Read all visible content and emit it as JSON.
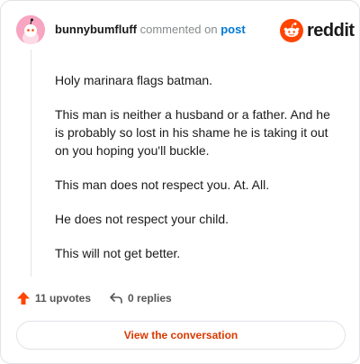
{
  "header": {
    "username": "bunnybumfluff",
    "commented_on": "commented on",
    "post_link": "post",
    "brand": "reddit"
  },
  "comment": {
    "paragraphs": [
      "Holy marinara flags batman.",
      "This man is neither a husband or a father. And he is probably so lost in his shame he is taking it out on you hoping you'll buckle.",
      "This man does not respect you. At. All.",
      "He does not respect your child.",
      "This will not get better."
    ]
  },
  "actions": {
    "upvotes": "11 upvotes",
    "replies": "0 replies"
  },
  "cta": {
    "label": "View the conversation"
  },
  "colors": {
    "brand_orange": "#ff4500",
    "link_blue": "#0079d3",
    "cta_text": "#d93a00"
  },
  "icons": {
    "avatar": "snoo-avatar",
    "brand": "reddit-logo-icon",
    "upvote": "upvote-arrow-icon",
    "reply": "reply-arrow-icon"
  }
}
